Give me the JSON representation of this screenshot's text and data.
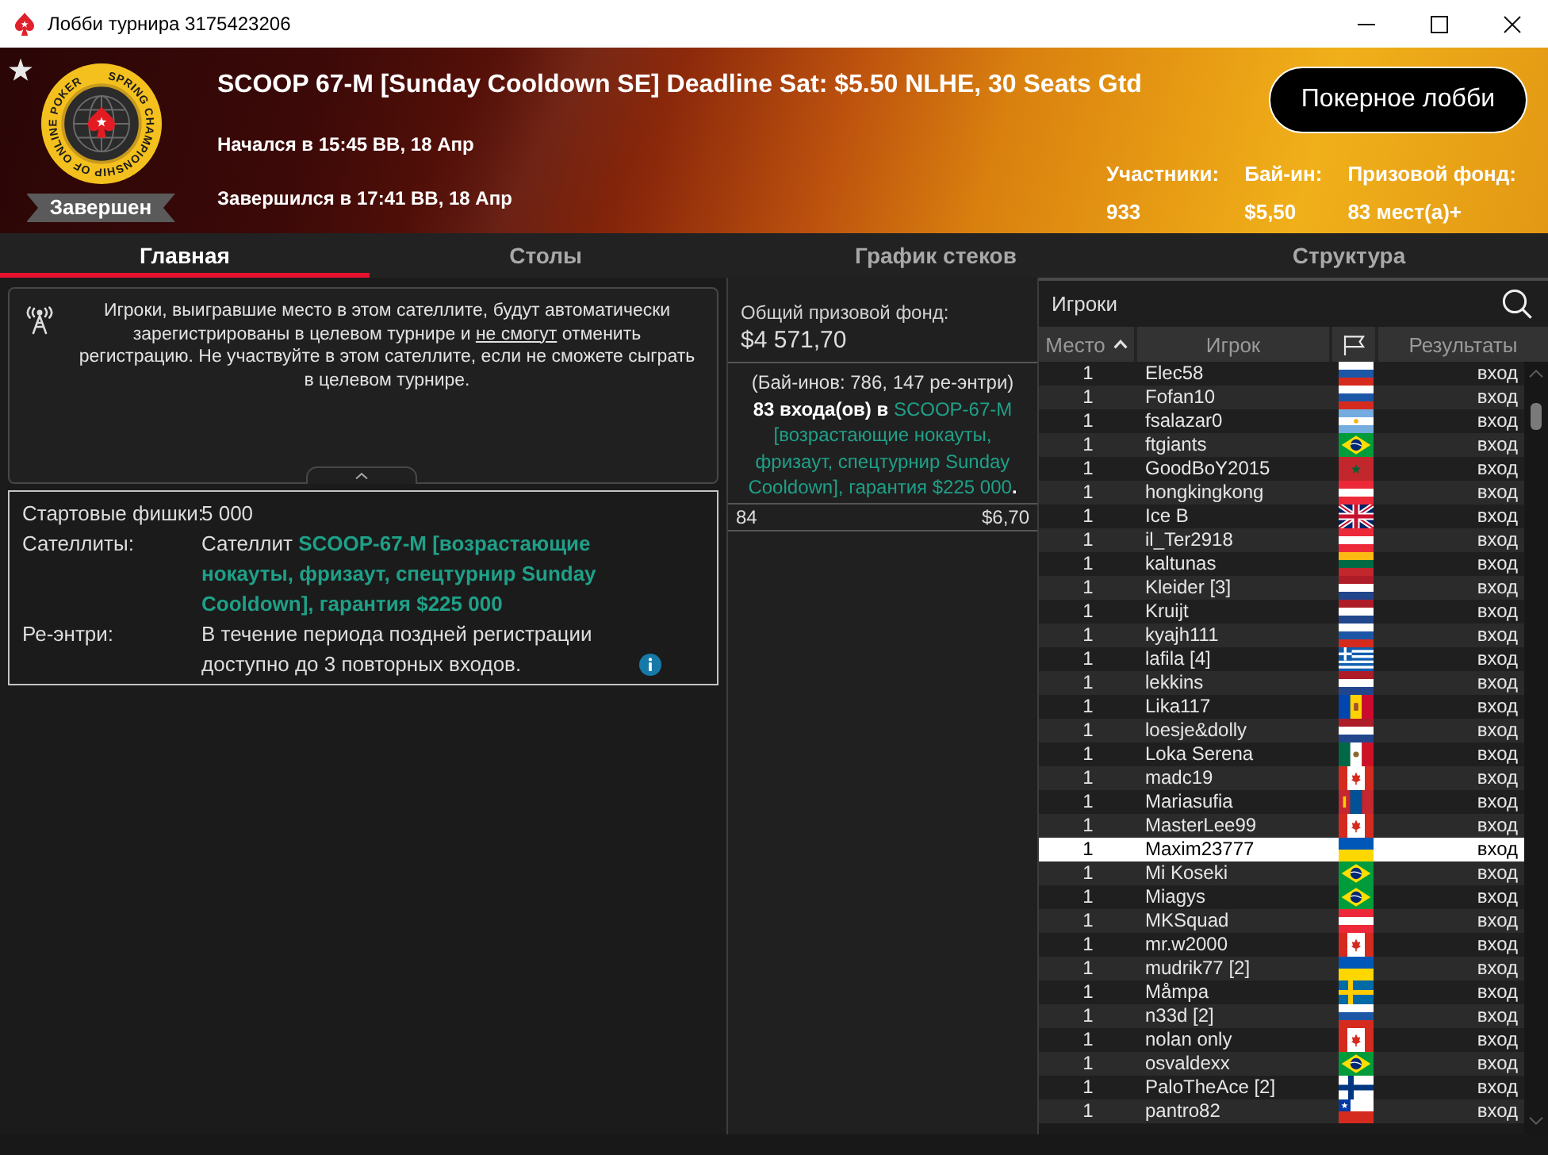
{
  "window": {
    "title": "Лобби турнира 3175423206"
  },
  "header": {
    "logo_text": "SPRING CHAMPIONSHIP OF ONLINE POKER",
    "status": "Завершен",
    "title": "SCOOP 67-M [Sunday Cooldown SE] Deadline Sat: $5.50 NLHE, 30 Seats Gtd",
    "started": "Начался в 15:45 ВВ, 18 Апр",
    "ended": "Завершился в 17:41 ВВ, 18 Апр",
    "lobby_button": "Покерное лобби",
    "stats": [
      {
        "label": "Участники:",
        "value": "933"
      },
      {
        "label": "Бай-ин:",
        "value": "$5,50"
      },
      {
        "label": "Призовой фонд:",
        "value": "83 мест(а)+"
      }
    ]
  },
  "tabs": [
    {
      "label": "Главная",
      "selected": true
    },
    {
      "label": "Столы",
      "selected": false
    },
    {
      "label": "График стеков",
      "selected": false
    },
    {
      "label": "Структура",
      "selected": false
    }
  ],
  "notice": {
    "segments": [
      {
        "text": "Игроки, выигравшие место в этом сателлите, будут автоматически зарегистрированы в целевом турнире и ",
        "kind": "plain"
      },
      {
        "text": "не смогут",
        "kind": "underline"
      },
      {
        "text": " отменить регистрацию. Не участвуйте в этом сателлите, если не сможете сыграть в целевом турнире.",
        "kind": "plain"
      }
    ]
  },
  "details": [
    {
      "label": "Стартовые фишки:",
      "segments": [
        {
          "text": "5 000",
          "kind": "plain"
        }
      ],
      "info": false
    },
    {
      "label": "Сателлиты:",
      "segments": [
        {
          "text": "Сателлит ",
          "kind": "plain"
        },
        {
          "text": "SCOOP-67-M [возрастающие нокауты, фризаут, спецтурнир Sunday Cooldown], гарантия $225 000",
          "kind": "highlight"
        }
      ],
      "info": false
    },
    {
      "label": "Ре-энтри:",
      "segments": [
        {
          "text": "В течение периода поздней регистрации доступно до 3 повторных входов.",
          "kind": "plain"
        }
      ],
      "info": true
    }
  ],
  "prize_pool": {
    "label": "Общий призовой фонд:",
    "amount": "$4 571,70",
    "entries_note": "(Бай-инов: 786, 147 ре-энтри)",
    "summary": [
      {
        "text": "83 входа(ов) в ",
        "kind": "bold"
      },
      {
        "text": "SCOOP-67-M [возрастающие нокауты, фризаут, спецтурнир Sunday Cooldown], гарантия $225 000",
        "kind": "accent"
      },
      {
        "text": ".",
        "kind": "bold"
      }
    ],
    "payouts": [
      {
        "place": "84",
        "prize": "$6,70"
      }
    ]
  },
  "players": {
    "title": "Игроки",
    "columns": [
      {
        "kind": "text",
        "label": "Место",
        "sorted": true
      },
      {
        "kind": "text",
        "label": "Игрок",
        "sorted": false
      },
      {
        "kind": "flag",
        "sorted": false
      },
      {
        "kind": "text",
        "label": "Результаты",
        "sorted": false
      }
    ],
    "rows": [
      {
        "place": "1",
        "name": "Elec58",
        "flag": {
          "kind": "ru"
        },
        "result": "вход",
        "selected": false
      },
      {
        "place": "1",
        "name": "Fofan10",
        "flag": {
          "kind": "ru"
        },
        "result": "вход",
        "selected": false
      },
      {
        "place": "1",
        "name": "fsalazar0",
        "flag": {
          "kind": "ar"
        },
        "result": "вход",
        "selected": false
      },
      {
        "place": "1",
        "name": "ftgiants",
        "flag": {
          "kind": "br"
        },
        "result": "вход",
        "selected": false
      },
      {
        "place": "1",
        "name": "GoodBoY2015",
        "flag": {
          "kind": "ma"
        },
        "result": "вход",
        "selected": false
      },
      {
        "place": "1",
        "name": "hongkingkong",
        "flag": {
          "kind": "at"
        },
        "result": "вход",
        "selected": false
      },
      {
        "place": "1",
        "name": "Ice B",
        "flag": {
          "kind": "gb"
        },
        "result": "вход",
        "selected": false
      },
      {
        "place": "1",
        "name": "il_Ter2918",
        "flag": {
          "kind": "at"
        },
        "result": "вход",
        "selected": false
      },
      {
        "place": "1",
        "name": "kaltunas",
        "flag": {
          "kind": "lt"
        },
        "result": "вход",
        "selected": false
      },
      {
        "place": "1",
        "name": "Kleider [3]",
        "flag": {
          "kind": "nl"
        },
        "result": "вход",
        "selected": false
      },
      {
        "place": "1",
        "name": "Kruijt",
        "flag": {
          "kind": "nl"
        },
        "result": "вход",
        "selected": false
      },
      {
        "place": "1",
        "name": "kyajh111",
        "flag": {
          "kind": "ru"
        },
        "result": "вход",
        "selected": false
      },
      {
        "place": "1",
        "name": "lafila [4]",
        "flag": {
          "kind": "gr"
        },
        "result": "вход",
        "selected": false
      },
      {
        "place": "1",
        "name": "lekkins",
        "flag": {
          "kind": "nl"
        },
        "result": "вход",
        "selected": false
      },
      {
        "place": "1",
        "name": "Lika117",
        "flag": {
          "kind": "md"
        },
        "result": "вход",
        "selected": false
      },
      {
        "place": "1",
        "name": "loesje&dolly",
        "flag": {
          "kind": "nl"
        },
        "result": "вход",
        "selected": false
      },
      {
        "place": "1",
        "name": "Loka Serena",
        "flag": {
          "kind": "mx"
        },
        "result": "вход",
        "selected": false
      },
      {
        "place": "1",
        "name": "madc19",
        "flag": {
          "kind": "ca"
        },
        "result": "вход",
        "selected": false
      },
      {
        "place": "1",
        "name": "Mariasufia",
        "flag": {
          "kind": "mn"
        },
        "result": "вход",
        "selected": false
      },
      {
        "place": "1",
        "name": "MasterLee99",
        "flag": {
          "kind": "ca"
        },
        "result": "вход",
        "selected": false
      },
      {
        "place": "1",
        "name": "Maxim23777",
        "flag": {
          "kind": "ua"
        },
        "result": "вход",
        "selected": true
      },
      {
        "place": "1",
        "name": "Mi Koseki",
        "flag": {
          "kind": "br"
        },
        "result": "вход",
        "selected": false
      },
      {
        "place": "1",
        "name": "Miagys",
        "flag": {
          "kind": "br"
        },
        "result": "вход",
        "selected": false
      },
      {
        "place": "1",
        "name": "MKSquad",
        "flag": {
          "kind": "at"
        },
        "result": "вход",
        "selected": false
      },
      {
        "place": "1",
        "name": "mr.w2000",
        "flag": {
          "kind": "ca"
        },
        "result": "вход",
        "selected": false
      },
      {
        "place": "1",
        "name": "mudrik77 [2]",
        "flag": {
          "kind": "ua"
        },
        "result": "вход",
        "selected": false
      },
      {
        "place": "1",
        "name": "Måmpa",
        "flag": {
          "kind": "se"
        },
        "result": "вход",
        "selected": false
      },
      {
        "place": "1",
        "name": "n33d [2]",
        "flag": {
          "kind": "ru"
        },
        "result": "вход",
        "selected": false
      },
      {
        "place": "1",
        "name": "nolan only",
        "flag": {
          "kind": "ca"
        },
        "result": "вход",
        "selected": false
      },
      {
        "place": "1",
        "name": "osvaldexx",
        "flag": {
          "kind": "br"
        },
        "result": "вход",
        "selected": false
      },
      {
        "place": "1",
        "name": "PaloTheAce [2]",
        "flag": {
          "kind": "fi"
        },
        "result": "вход",
        "selected": false
      },
      {
        "place": "1",
        "name": "pantro82",
        "flag": {
          "kind": "cl"
        },
        "result": "вход",
        "selected": false
      }
    ]
  }
}
